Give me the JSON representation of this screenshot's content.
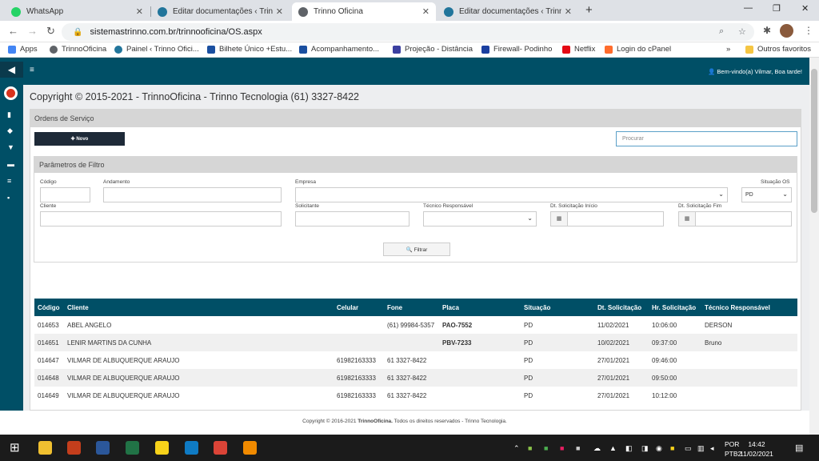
{
  "browser": {
    "tabs": [
      {
        "label": "WhatsApp",
        "icon": "whatsapp-icon",
        "color": "#25d366"
      },
      {
        "label": "Editar documentações ‹ Trinno O",
        "icon": "wordpress-icon",
        "color": "#21759b"
      },
      {
        "label": "Trinno Oficina",
        "icon": "globe-icon",
        "color": "#5f6368"
      },
      {
        "label": "Editar documentações ‹ Trinno O",
        "icon": "wordpress-icon",
        "color": "#21759b"
      }
    ],
    "close_glyph": "✕",
    "new_tab": "+",
    "minimize": "—",
    "restore": "❐",
    "close_window": "✕",
    "back": "←",
    "forward": "→",
    "reload": "↻",
    "lock": "🔒",
    "url": "sistemastrinno.com.br/trinnooficina/OS.aspx",
    "zoom_icon": "⌕",
    "star_icon": "☆",
    "ext_icon": "✱",
    "menu_icon": "⋮",
    "bookmarks": [
      {
        "label": "Apps",
        "icon": "apps-grid-icon",
        "color": "#4285f4"
      },
      {
        "label": "TrinnoOficina",
        "icon": "globe-icon",
        "color": "#5f6368"
      },
      {
        "label": "Painel ‹ Trinno Ofici...",
        "icon": "wordpress-icon",
        "color": "#21759b"
      },
      {
        "label": "Bilhete Único +Estu...",
        "icon": "bookmark-icon",
        "color": "#1a4fa0"
      },
      {
        "label": "Acompanhamento...",
        "icon": "bookmark-icon",
        "color": "#1a4fa0"
      },
      {
        "label": "Projeção - Distância",
        "icon": "bookmark-icon",
        "color": "#3b3fa0"
      },
      {
        "label": "Firewall- Podinho",
        "icon": "bookmark-icon",
        "color": "#1a3fa0"
      },
      {
        "label": "Netflix",
        "icon": "netflix-icon",
        "color": "#e50914"
      },
      {
        "label": "Login do cPanel",
        "icon": "cpanel-icon",
        "color": "#ff6c2c"
      }
    ],
    "more_bookmarks": "»",
    "other_favorites": "Outros favoritos"
  },
  "app": {
    "hamburger": "≡",
    "welcome": "Bem-vindo(a) Vilmar, Boa tarde!",
    "sidebar_icons": [
      "database-icon",
      "share-icon",
      "download-icon",
      "print-icon",
      "list-icon",
      "report-icon"
    ],
    "copyright_top": "Copyright © 2015-2021 - TrinnoOficina - Trinno Tecnologia (61) 3327-8422",
    "panel_title": "Ordens de Serviço",
    "new_button": "✚ Novo",
    "search_placeholder": "Procurar",
    "filter": {
      "title": "Parâmetros de Filtro",
      "codigo": "Código",
      "andamento": "Andamento",
      "empresa": "Empresa",
      "situacao": "Situação OS",
      "situacao_value": "PD",
      "cliente": "Cliente",
      "solicitante": "Solicitante",
      "tecnico": "Técnico Responsável",
      "dt_inicio": "Dt. Solicitação Início",
      "dt_fim": "Dt. Solicitação Fim",
      "filter_button": "🔍 Filtrar",
      "calendar_glyph": "▦",
      "chevron": "⌄"
    },
    "table": {
      "columns": [
        "Código",
        "Cliente",
        "Celular",
        "Fone",
        "Placa",
        "Situação",
        "Dt. Solicitação",
        "Hr. Solicitação",
        "Técnico Responsável"
      ],
      "rows": [
        [
          "014653",
          "ABEL ANGELO",
          "",
          "(61) 99984-5357",
          "PAO-7552",
          "PD",
          "11/02/2021",
          "10:06:00",
          "DERSON"
        ],
        [
          "014651",
          "LENIR MARTINS DA CUNHA",
          "",
          "",
          "PBV-7233",
          "PD",
          "10/02/2021",
          "09:37:00",
          "Bruno"
        ],
        [
          "014647",
          "VILMAR DE ALBUQUERQUE ARAUJO",
          "61982163333",
          "61 3327-8422",
          "",
          "PD",
          "27/01/2021",
          "09:46:00",
          ""
        ],
        [
          "014648",
          "VILMAR DE ALBUQUERQUE ARAUJO",
          "61982163333",
          "61 3327-8422",
          "",
          "PD",
          "27/01/2021",
          "09:50:00",
          ""
        ],
        [
          "014649",
          "VILMAR DE ALBUQUERQUE ARAUJO",
          "61982163333",
          "61 3327-8422",
          "",
          "PD",
          "27/01/2021",
          "10:12:00",
          ""
        ]
      ]
    },
    "footer_pre": "Copyright © 2016-2021 ",
    "footer_brand": "TrinnoOficina.",
    "footer_post": " Todos os direitos reservados - Trinno Tecnologia."
  },
  "taskbar": {
    "windows_glyph": "⊞",
    "apps": [
      {
        "name": "file-explorer-icon",
        "color": "#f0c030"
      },
      {
        "name": "powerpoint-icon",
        "color": "#c43e1c"
      },
      {
        "name": "word-icon",
        "color": "#2b579a"
      },
      {
        "name": "excel-icon",
        "color": "#217346"
      },
      {
        "name": "sticky-notes-icon",
        "color": "#f7d21a"
      },
      {
        "name": "edge-icon",
        "color": "#0f7bc4"
      },
      {
        "name": "chrome-icon",
        "color": "#db4437"
      },
      {
        "name": "vlc-icon",
        "color": "#f08a00"
      }
    ],
    "tray_up": "⌃",
    "lang_top": "POR",
    "lang_bottom": "PTB2",
    "time": "14:42",
    "date": "11/02/2021",
    "notif_glyph": "▤"
  }
}
